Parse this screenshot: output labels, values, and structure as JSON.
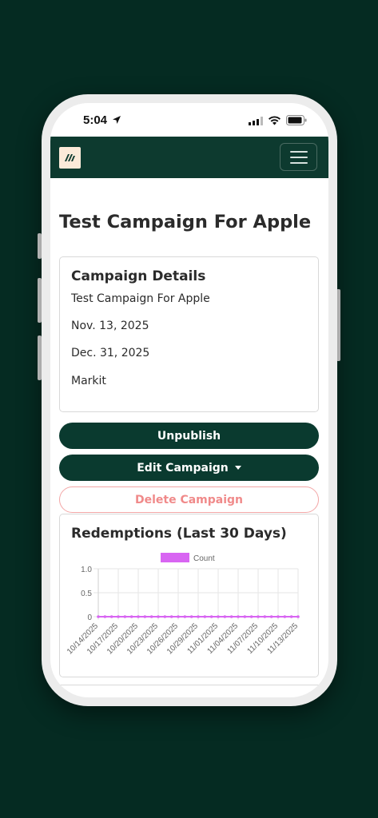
{
  "status_bar": {
    "time": "5:04"
  },
  "page": {
    "title": "Test Campaign For Apple"
  },
  "details": {
    "heading": "Campaign Details",
    "name": "Test Campaign For Apple",
    "start_date": "Nov. 13, 2025",
    "end_date": "Dec. 31, 2025",
    "brand": "Markit"
  },
  "actions": {
    "unpublish": "Unpublish",
    "edit": "Edit Campaign",
    "delete": "Delete Campaign"
  },
  "colors": {
    "brand_dark": "#0a3a2f",
    "danger": "#f08a8a",
    "series": "#d865f2"
  },
  "chart_heading": "Redemptions (Last 30 Days)",
  "chart_data": {
    "type": "line",
    "series": [
      {
        "name": "Count",
        "values": [
          0,
          0,
          0,
          0,
          0,
          0,
          0,
          0,
          0,
          0,
          0,
          0,
          0,
          0,
          0,
          0,
          0,
          0,
          0,
          0,
          0,
          0,
          0,
          0,
          0,
          0,
          0,
          0,
          0,
          0,
          0
        ]
      }
    ],
    "x_tick_labels": [
      "10/14/2025",
      "10/17/2025",
      "10/20/2025",
      "10/23/2025",
      "10/26/2025",
      "10/29/2025",
      "11/01/2025",
      "11/04/2025",
      "11/07/2025",
      "11/10/2025",
      "11/13/2025"
    ],
    "x_range": [
      "10/14/2025",
      "11/13/2025"
    ],
    "y_tick_labels": [
      "1.0",
      "0.5",
      "0"
    ],
    "ylim": [
      0,
      1
    ],
    "legend": "top",
    "grid": true
  }
}
